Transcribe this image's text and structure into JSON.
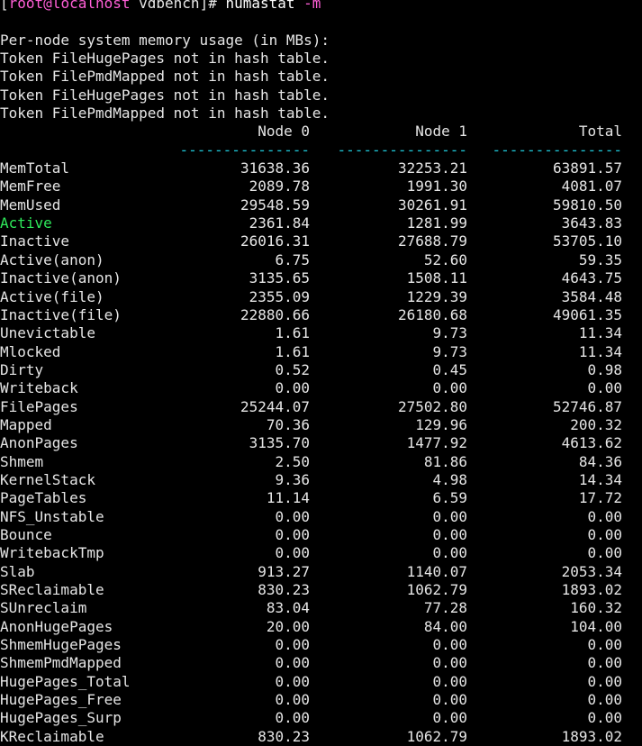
{
  "prompt": {
    "open": "[",
    "user_host": "root@localhost",
    "dir": " vdbench]# ",
    "command": "numastat",
    "flag": "-m"
  },
  "messages": [
    "Per-node system memory usage (in MBs):",
    "Token FileHugePages not in hash table.",
    "Token FilePmdMapped not in hash table.",
    "Token FileHugePages not in hash table.",
    "Token FilePmdMapped not in hash table."
  ],
  "headers": {
    "node0": "Node 0",
    "node1": "Node 1",
    "total": "Total"
  },
  "separator": "---------------",
  "rows": [
    {
      "label": "MemTotal",
      "node0": "31638.36",
      "node1": "32253.21",
      "total": "63891.57"
    },
    {
      "label": "MemFree",
      "node0": "2089.78",
      "node1": "1991.30",
      "total": "4081.07"
    },
    {
      "label": "MemUsed",
      "node0": "29548.59",
      "node1": "30261.91",
      "total": "59810.50"
    },
    {
      "label": "Active",
      "node0": "2361.84",
      "node1": "1281.99",
      "total": "3643.83"
    },
    {
      "label": "Inactive",
      "node0": "26016.31",
      "node1": "27688.79",
      "total": "53705.10"
    },
    {
      "label": "Active(anon)",
      "node0": "6.75",
      "node1": "52.60",
      "total": "59.35"
    },
    {
      "label": "Inactive(anon)",
      "node0": "3135.65",
      "node1": "1508.11",
      "total": "4643.75"
    },
    {
      "label": "Active(file)",
      "node0": "2355.09",
      "node1": "1229.39",
      "total": "3584.48"
    },
    {
      "label": "Inactive(file)",
      "node0": "22880.66",
      "node1": "26180.68",
      "total": "49061.35"
    },
    {
      "label": "Unevictable",
      "node0": "1.61",
      "node1": "9.73",
      "total": "11.34"
    },
    {
      "label": "Mlocked",
      "node0": "1.61",
      "node1": "9.73",
      "total": "11.34"
    },
    {
      "label": "Dirty",
      "node0": "0.52",
      "node1": "0.45",
      "total": "0.98"
    },
    {
      "label": "Writeback",
      "node0": "0.00",
      "node1": "0.00",
      "total": "0.00"
    },
    {
      "label": "FilePages",
      "node0": "25244.07",
      "node1": "27502.80",
      "total": "52746.87"
    },
    {
      "label": "Mapped",
      "node0": "70.36",
      "node1": "129.96",
      "total": "200.32"
    },
    {
      "label": "AnonPages",
      "node0": "3135.70",
      "node1": "1477.92",
      "total": "4613.62"
    },
    {
      "label": "Shmem",
      "node0": "2.50",
      "node1": "81.86",
      "total": "84.36"
    },
    {
      "label": "KernelStack",
      "node0": "9.36",
      "node1": "4.98",
      "total": "14.34"
    },
    {
      "label": "PageTables",
      "node0": "11.14",
      "node1": "6.59",
      "total": "17.72"
    },
    {
      "label": "NFS_Unstable",
      "node0": "0.00",
      "node1": "0.00",
      "total": "0.00"
    },
    {
      "label": "Bounce",
      "node0": "0.00",
      "node1": "0.00",
      "total": "0.00"
    },
    {
      "label": "WritebackTmp",
      "node0": "0.00",
      "node1": "0.00",
      "total": "0.00"
    },
    {
      "label": "Slab",
      "node0": "913.27",
      "node1": "1140.07",
      "total": "2053.34"
    },
    {
      "label": "SReclaimable",
      "node0": "830.23",
      "node1": "1062.79",
      "total": "1893.02"
    },
    {
      "label": "SUnreclaim",
      "node0": "83.04",
      "node1": "77.28",
      "total": "160.32"
    },
    {
      "label": "AnonHugePages",
      "node0": "20.00",
      "node1": "84.00",
      "total": "104.00"
    },
    {
      "label": "ShmemHugePages",
      "node0": "0.00",
      "node1": "0.00",
      "total": "0.00"
    },
    {
      "label": "ShmemPmdMapped",
      "node0": "0.00",
      "node1": "0.00",
      "total": "0.00"
    },
    {
      "label": "HugePages_Total",
      "node0": "0.00",
      "node1": "0.00",
      "total": "0.00"
    },
    {
      "label": "HugePages_Free",
      "node0": "0.00",
      "node1": "0.00",
      "total": "0.00"
    },
    {
      "label": "HugePages_Surp",
      "node0": "0.00",
      "node1": "0.00",
      "total": "0.00"
    },
    {
      "label": "KReclaimable",
      "node0": "830.23",
      "node1": "1062.79",
      "total": "1893.02"
    }
  ],
  "colors": {
    "background": "#000000",
    "text": "#e6e6e6",
    "prompt_user": "#ff5fd7",
    "separator": "#1fc8d8",
    "active_label": "#2ee85a"
  }
}
